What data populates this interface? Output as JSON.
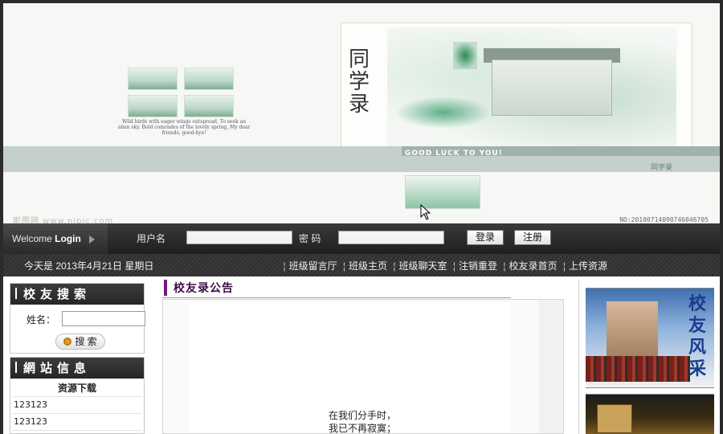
{
  "banner": {
    "title_cn": "同学录",
    "good_luck": "GOOD LUCK TO YOU!",
    "stamp": "同学录",
    "poem_small": "Wild birds with eager wings outspread, To seek an alien sky. Bold comrades of the lovely spring, My dear friends, good-bye!",
    "watermark": "昵图网 www.nipic.com",
    "serial": "NO:20100714090746046705"
  },
  "login": {
    "welcome_prefix": "Welcome",
    "welcome_bold": "Login",
    "username_label": "用户名",
    "password_label": "密 码",
    "username_value": "",
    "password_value": "",
    "login_button": "登录",
    "register_button": "注册"
  },
  "nav": {
    "today": "今天是 2013年4月21日 星期日",
    "links": [
      "班级留言厅",
      "班级主页",
      "班级聊天室",
      "注销重登",
      "校友录首页",
      "上传资源"
    ]
  },
  "left": {
    "search_title": "校友搜索",
    "name_label": "姓名：",
    "name_value": "",
    "search_button": "搜 索",
    "site_title": "網站信息",
    "download_header": "资源下载",
    "downloads": [
      "123123",
      "123123"
    ]
  },
  "main": {
    "announcement_title": "校友录公告",
    "announcement_lines": [
      "在我们分手时，",
      "我已不再寂寞；"
    ]
  },
  "right": {
    "photo_caption": "校友风采"
  },
  "colors": {
    "frame": "#2b2b2b",
    "bar": "#1f1f1f",
    "accent_purple": "#6a1e77",
    "caption_blue": "#1d3c8e"
  }
}
